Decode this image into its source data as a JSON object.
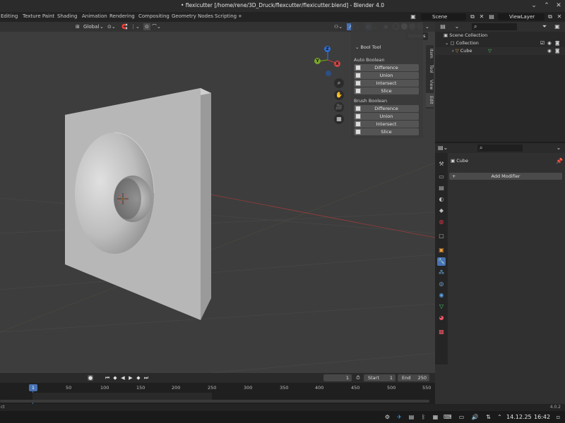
{
  "window": {
    "title": "• flexicutter [/home/rene/3D_Druck/flexcutter/flexicutter.blend] - Blender 4.0"
  },
  "workspaces": [
    "Editing",
    "Texture Paint",
    "Shading",
    "Animation",
    "Rendering",
    "Compositing",
    "Geometry Nodes",
    "Scripting"
  ],
  "scene": {
    "label": "Scene"
  },
  "viewlayer": {
    "label": "ViewLayer"
  },
  "viewport": {
    "orientation": "Global",
    "options_label": "Options",
    "gizmo": {
      "x": "X",
      "y": "Y",
      "z": "Z"
    }
  },
  "boolpanel": {
    "title": "Bool Tool",
    "auto_heading": "Auto Boolean",
    "auto_buttons": [
      "Difference",
      "Union",
      "Intersect",
      "Slice"
    ],
    "brush_heading": "Brush Boolean",
    "brush_buttons": [
      "Difference",
      "Union",
      "Intersect",
      "Slice"
    ],
    "side_tabs": [
      "Item",
      "Tool",
      "View",
      "Edit"
    ]
  },
  "outliner": {
    "rows": [
      {
        "label": "Scene Collection"
      },
      {
        "label": "Collection"
      },
      {
        "label": "Cube"
      }
    ]
  },
  "properties": {
    "object_name": "Cube",
    "add_modifier": "Add Modifier"
  },
  "timeline": {
    "current_frame": "1",
    "start_label": "Start",
    "start_value": "1",
    "end_label": "End",
    "end_value": "250",
    "playhead": "1",
    "ticks": [
      "50",
      "100",
      "150",
      "200",
      "250",
      "300",
      "350",
      "400",
      "450",
      "500",
      "550"
    ]
  },
  "status": {
    "left": "ct",
    "version": "4.0.2"
  },
  "taskbar": {
    "date": "14.12.25",
    "time": "16:42"
  },
  "colors": {
    "accent": "#4772b3",
    "viewport_bg": "#3d3d3d",
    "panel_bg": "#303030"
  }
}
